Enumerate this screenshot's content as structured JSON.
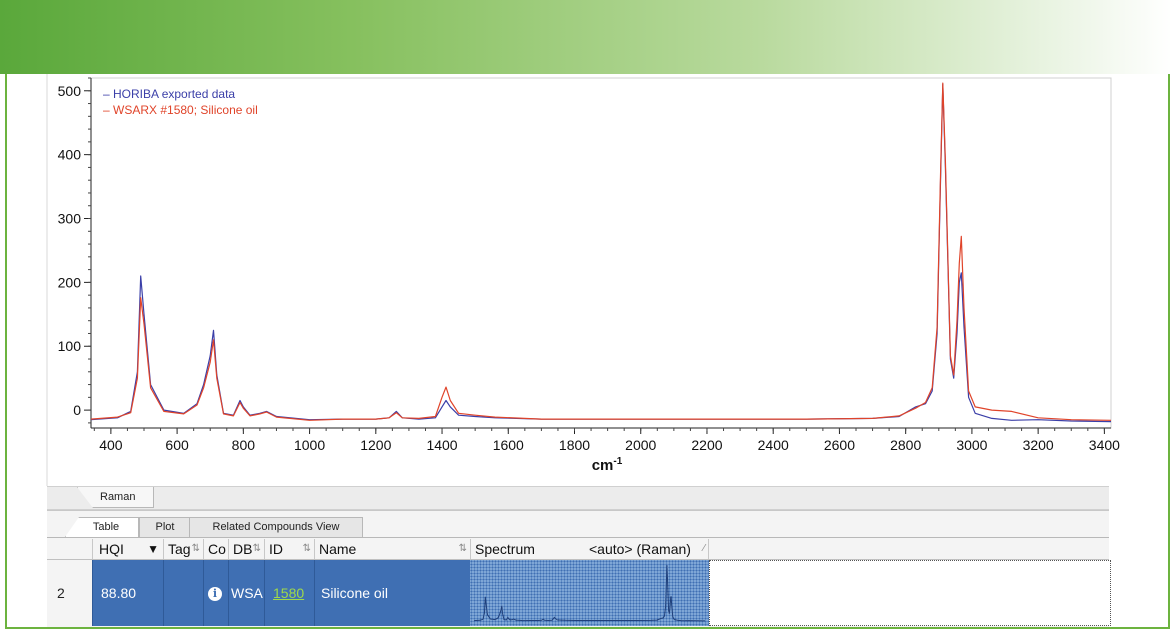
{
  "chart_data": {
    "type": "line",
    "xlabel": "cm",
    "xlabel_sup": "-1",
    "xlim": [
      340,
      3420
    ],
    "ylim": [
      -28,
      520
    ],
    "x_ticks": [
      400,
      600,
      800,
      1000,
      1200,
      1400,
      1600,
      1800,
      2000,
      2200,
      2400,
      2600,
      2800,
      3000,
      3200,
      3400
    ],
    "y_ticks": [
      0,
      100,
      200,
      300,
      400,
      500
    ],
    "legend_placement": "top-left",
    "series": [
      {
        "name": "HORIBA exported data",
        "color": "#3b3fa8",
        "x": [
          340,
          420,
          460,
          480,
          490,
          500,
          520,
          560,
          620,
          660,
          680,
          700,
          710,
          720,
          740,
          770,
          790,
          800,
          820,
          850,
          870,
          900,
          1000,
          1100,
          1200,
          1240,
          1262,
          1280,
          1330,
          1380,
          1400,
          1412,
          1425,
          1450,
          1500,
          1560,
          1700,
          1900,
          2100,
          2300,
          2500,
          2700,
          2780,
          2830,
          2860,
          2880,
          2895,
          2905,
          2912,
          2920,
          2935,
          2945,
          2955,
          2962,
          2968,
          2976,
          2990,
          3010,
          3060,
          3120,
          3200,
          3300,
          3420
        ],
        "y": [
          -15,
          -12,
          -2,
          60,
          210,
          150,
          40,
          0,
          -5,
          10,
          40,
          85,
          125,
          55,
          -5,
          -8,
          15,
          5,
          -8,
          -5,
          -2,
          -10,
          -15,
          -14,
          -14,
          -12,
          -2,
          -12,
          -14,
          -12,
          5,
          15,
          5,
          -8,
          -10,
          -12,
          -14,
          -14,
          -14,
          -14,
          -14,
          -13,
          -10,
          5,
          10,
          30,
          120,
          350,
          510,
          380,
          80,
          50,
          120,
          200,
          215,
          130,
          20,
          -5,
          -13,
          -16,
          -15,
          -17,
          -18
        ]
      },
      {
        "name": "WSARX #1580; Silicone oil",
        "color": "#e0442a",
        "x": [
          340,
          420,
          460,
          480,
          490,
          500,
          520,
          560,
          620,
          660,
          680,
          700,
          710,
          720,
          740,
          770,
          790,
          800,
          820,
          850,
          870,
          900,
          1000,
          1100,
          1200,
          1240,
          1262,
          1280,
          1330,
          1380,
          1400,
          1412,
          1425,
          1450,
          1500,
          1560,
          1700,
          1900,
          2100,
          2300,
          2500,
          2700,
          2780,
          2830,
          2860,
          2880,
          2895,
          2905,
          2912,
          2920,
          2935,
          2945,
          2955,
          2962,
          2968,
          2976,
          2990,
          3010,
          3060,
          3120,
          3200,
          3300,
          3420
        ],
        "y": [
          -14,
          -11,
          -4,
          50,
          176,
          135,
          35,
          -2,
          -6,
          8,
          35,
          75,
          110,
          50,
          -6,
          -9,
          12,
          3,
          -9,
          -6,
          -3,
          -11,
          -16,
          -14,
          -14,
          -12,
          -4,
          -12,
          -13,
          -10,
          20,
          36,
          15,
          -5,
          -8,
          -11,
          -14,
          -14,
          -14,
          -14,
          -14,
          -13,
          -9,
          3,
          12,
          35,
          130,
          360,
          512,
          390,
          85,
          55,
          140,
          230,
          272,
          160,
          30,
          5,
          0,
          -2,
          -12,
          -15,
          -16
        ]
      }
    ]
  },
  "bottom_tabs": {
    "raman": "Raman"
  },
  "result_tabs": {
    "table": "Table",
    "plot": "Plot",
    "related": "Related Compounds View"
  },
  "columns": {
    "hqi": "HQI",
    "tag": "Tag",
    "co": "Co",
    "db": "DB",
    "id": "ID",
    "name": "Name",
    "spectrum": "Spectrum",
    "spectrum_mode": "<auto> (Raman)"
  },
  "row": {
    "index": "2",
    "hqi": "88.80",
    "co_icon": "info-icon",
    "db": "WSARX",
    "id": "1580",
    "name": "Silicone oil"
  },
  "colors": {
    "banner": "#5aa83b",
    "frame": "#6cb33f",
    "selection": "#3f6fb3",
    "id_link": "#9fd94a"
  }
}
